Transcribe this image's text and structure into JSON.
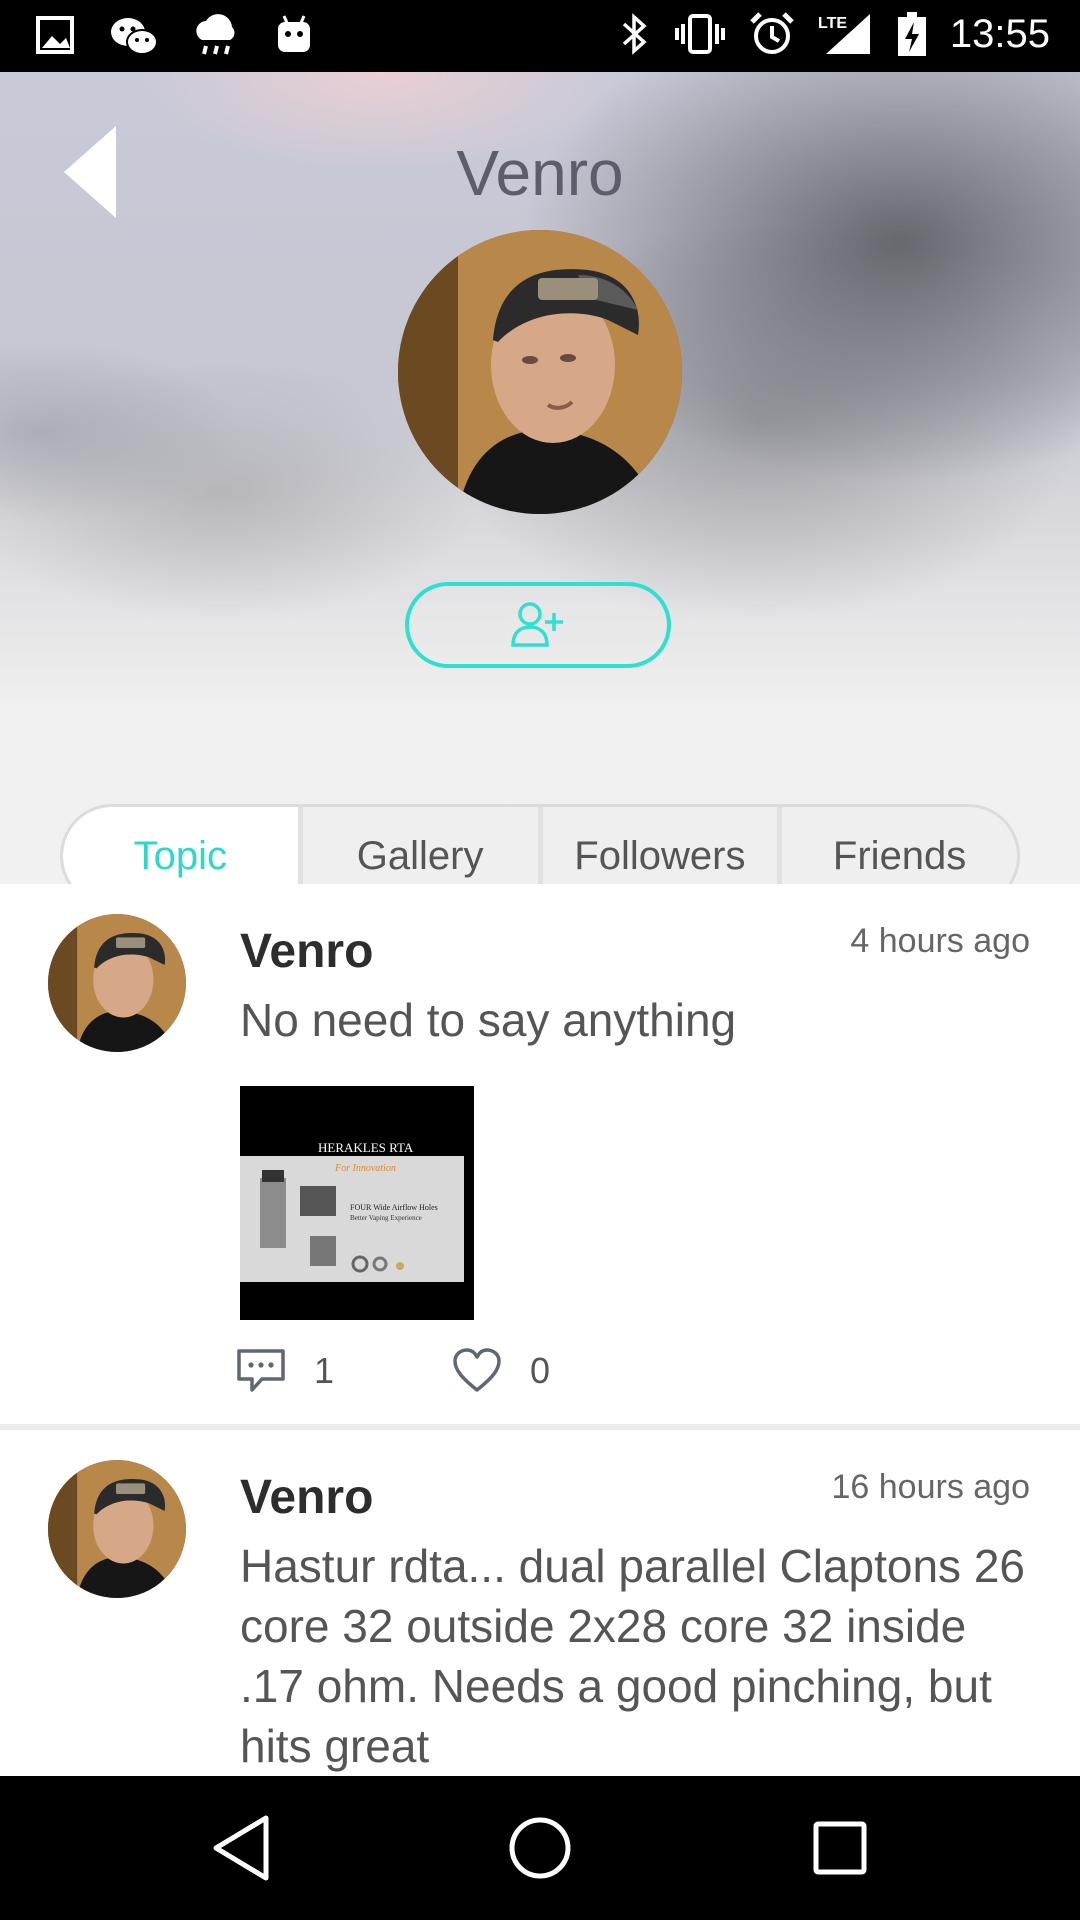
{
  "status_bar": {
    "time": "13:55",
    "network": "LTE",
    "icons": [
      "gallery-icon",
      "wechat-icon",
      "weather-rain-icon",
      "android-icon",
      "bluetooth-icon",
      "vibrate-icon",
      "alarm-icon",
      "signal-icon",
      "battery-charging-icon"
    ]
  },
  "header": {
    "title": "Venro",
    "back_icon": "back-arrow-icon",
    "follow_icon": "add-person-icon",
    "accent_color": "#2ee0cf"
  },
  "tabs": [
    {
      "label": "Topic",
      "active": true
    },
    {
      "label": "Gallery",
      "active": false
    },
    {
      "label": "Followers",
      "active": false
    },
    {
      "label": "Friends",
      "active": false
    }
  ],
  "posts": [
    {
      "author": "Venro",
      "time": "4 hours ago",
      "text": "No need to say anything",
      "image": {
        "brand": "HERAKLES RTA",
        "tagline": "For Innovation",
        "headline": "FOUR Wide Airflow Holes",
        "subline": "Better Vaping Experience"
      },
      "comments": "1",
      "likes": "0"
    },
    {
      "author": "Venro",
      "time": "16 hours ago",
      "text": "Hastur rdta... dual parallel Claptons 26 core 32 outside 2x28 core 32 inside .17 ohm. Needs a good pinching, but hits great"
    }
  ],
  "nav_bar": {
    "icons": [
      "nav-back-icon",
      "nav-home-icon",
      "nav-recents-icon"
    ]
  }
}
